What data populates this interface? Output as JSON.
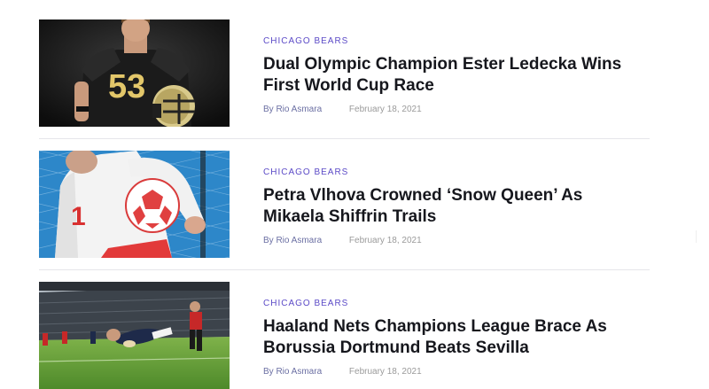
{
  "articles": [
    {
      "category": "CHICAGO BEARS",
      "title_line1": "Dual Olympic Champion Ester Ledecka Wins",
      "title_line2": "First World Cup Race",
      "author": "By Rio Asmara",
      "date": "February 18, 2021",
      "image_subject": "american-football-player-photo",
      "jersey_number": "53"
    },
    {
      "category": "CHICAGO BEARS",
      "title_line1": "Petra Vlhova Crowned ‘Snow Queen’ As",
      "title_line2": "Mikaela Shiffrin Trails",
      "author": "By Rio Asmara",
      "date": "February 18, 2021",
      "image_subject": "goalkeeper-with-ball-photo",
      "jersey_number": "1"
    },
    {
      "category": "CHICAGO BEARS",
      "title_line1": "Haaland Nets Champions League Brace As",
      "title_line2": "Borussia Dortmund Beats Sevilla",
      "author": "By Rio Asmara",
      "date": "February 18, 2021",
      "image_subject": "rugby-stadium-try-photo"
    }
  ],
  "colors": {
    "category": "#5b4ac7",
    "headline": "#16171d",
    "meta": "#9a9a9a",
    "divider": "#e6e6ea"
  }
}
